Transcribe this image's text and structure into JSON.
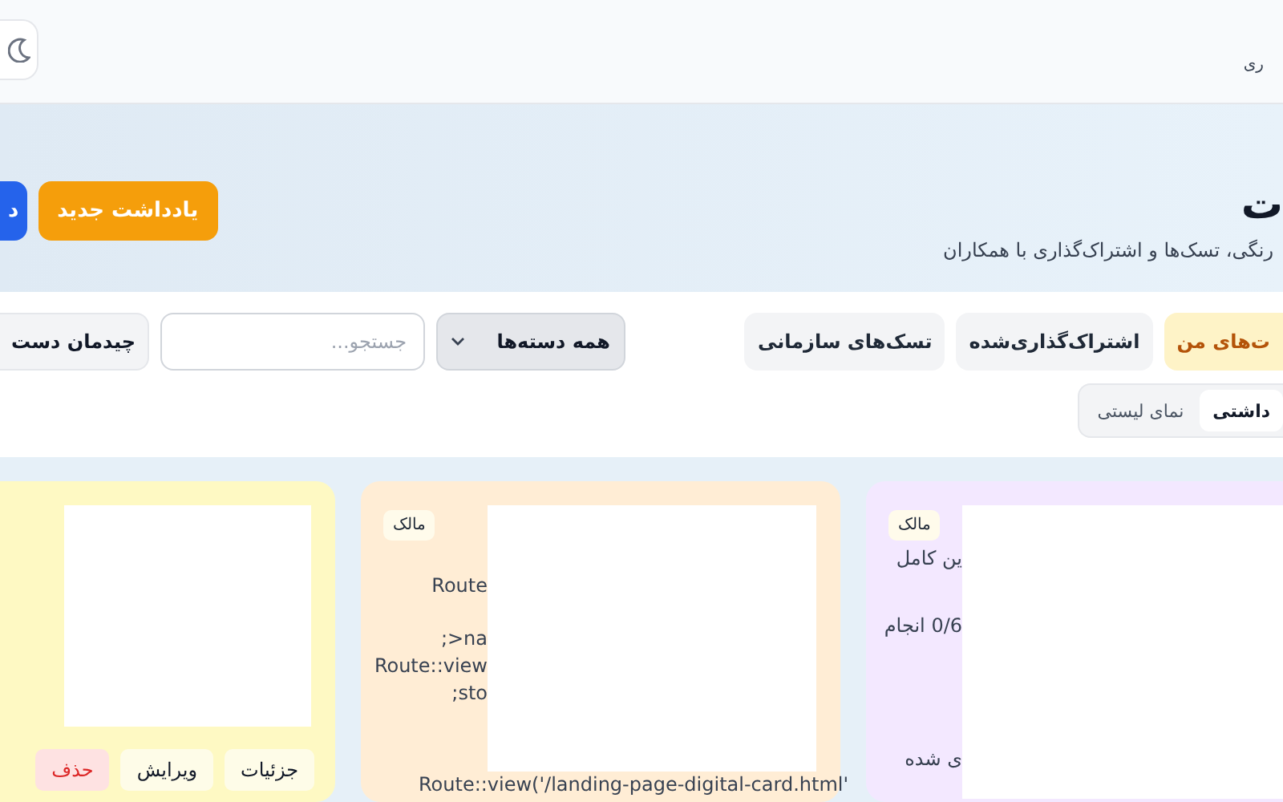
{
  "header": {
    "brand": "ری"
  },
  "hero": {
    "title": "ت",
    "subtitle": "رنگی، تسک‌ها و اشتراک‌گذاری با همکاران",
    "buttons": [
      {
        "label": "یادداشت جدید",
        "kind": "accent"
      },
      {
        "label": "د",
        "kind": "primary"
      }
    ]
  },
  "toolbar": {
    "tabs": [
      {
        "label": "ت‌های من",
        "selected": true
      },
      {
        "label": "اشتراک‌گذاری‌شده",
        "selected": false
      },
      {
        "label": "تسک‌های سازمانی",
        "selected": false
      }
    ],
    "category": "همه دسته‌ها",
    "search": {
      "placeholder": "جستجو..."
    },
    "layout_button": "چیدمان دست",
    "views": [
      {
        "label": "داشتی",
        "selected": true
      },
      {
        "label": "نمای لیستی",
        "selected": false
      }
    ]
  },
  "cards": [
    {
      "color": "#f3e8ff",
      "badge": "مالک",
      "lines": [
        "ین کامل",
        "0/6 انجام",
        "ی شده"
      ]
    },
    {
      "color": "#ffedd5",
      "badge": "مالک",
      "lines": [
        "Route",
        ";>na",
        "Route::view",
        ";sto"
      ],
      "footer": "Route::view('/landing-page-digital-card.html'"
    },
    {
      "color": "#fef9c3",
      "actions": [
        {
          "label": "جزئیات",
          "kind": "normal"
        },
        {
          "label": "ویرایش",
          "kind": "normal"
        },
        {
          "label": "حذف",
          "kind": "danger"
        }
      ]
    }
  ]
}
